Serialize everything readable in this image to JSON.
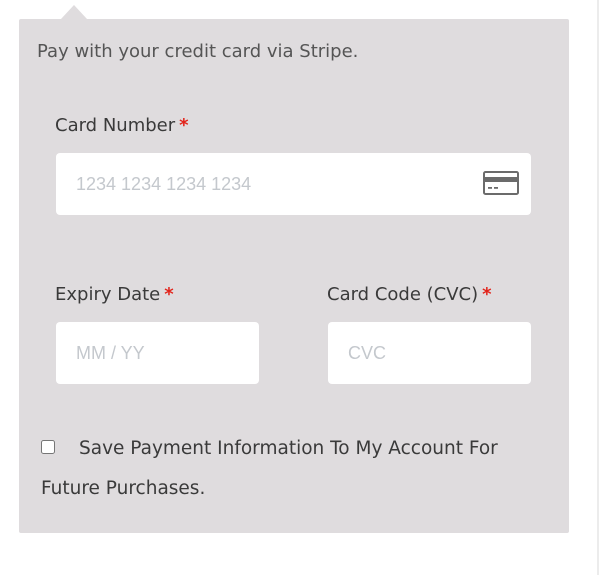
{
  "payment": {
    "description": "Pay with your credit card via Stripe.",
    "required_marker": "*",
    "card_number": {
      "label": "Card Number",
      "placeholder": "1234 1234 1234 1234",
      "icon": "credit-card-icon"
    },
    "expiry": {
      "label": "Expiry Date",
      "placeholder": "MM / YY"
    },
    "cvc": {
      "label": "Card Code (CVC)",
      "placeholder": "CVC"
    },
    "save_payment": {
      "label": "Save Payment Information To My Account For Future Purchases.",
      "checked": false
    }
  },
  "colors": {
    "panel_background": "#dfdcde",
    "required": "#e2231a",
    "placeholder": "#c4c8cd"
  }
}
